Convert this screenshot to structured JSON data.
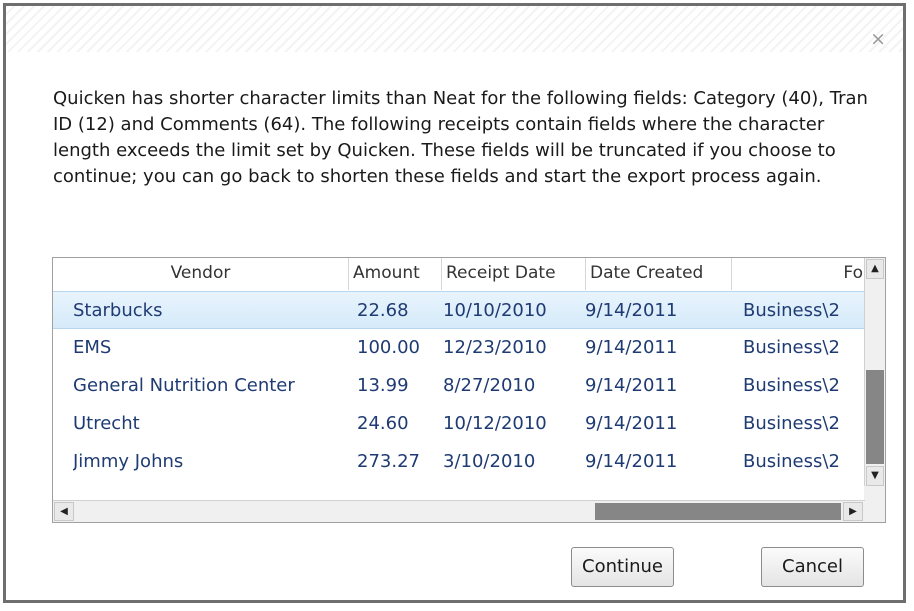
{
  "dialog": {
    "close_glyph": "×",
    "message": "Quicken has shorter character limits than Neat for the following fields: Category (40), Tran ID (12) and Comments (64). The following receipts contain fields where the character length exceeds the limit set by Quicken. These fields will be truncated if you choose to continue; you can go back to shorten these fields and start the export process again."
  },
  "table": {
    "columns": [
      "Vendor",
      "Amount",
      "Receipt Date",
      "Date Created",
      "Fo"
    ],
    "rows": [
      {
        "vendor": "Starbucks",
        "amount": "22.68",
        "receipt_date": "10/10/2010",
        "date_created": "9/14/2011",
        "folder": "Business\\2",
        "selected": true
      },
      {
        "vendor": "EMS",
        "amount": "100.00",
        "receipt_date": "12/23/2010",
        "date_created": "9/14/2011",
        "folder": "Business\\2",
        "selected": false
      },
      {
        "vendor": "General Nutrition Center",
        "amount": "13.99",
        "receipt_date": "8/27/2010",
        "date_created": "9/14/2011",
        "folder": "Business\\2",
        "selected": false
      },
      {
        "vendor": "Utrecht",
        "amount": "24.60",
        "receipt_date": "10/12/2010",
        "date_created": "9/14/2011",
        "folder": "Business\\2",
        "selected": false
      },
      {
        "vendor": "Jimmy Johns",
        "amount": "273.27",
        "receipt_date": "3/10/2010",
        "date_created": "9/14/2011",
        "folder": "Business\\2",
        "selected": false
      }
    ],
    "scroll_up_glyph": "▲",
    "scroll_down_glyph": "▼",
    "scroll_left_glyph": "◀",
    "scroll_right_glyph": "▶"
  },
  "buttons": {
    "continue": "Continue",
    "cancel": "Cancel"
  },
  "colors": {
    "selected_row": "#dbeefb",
    "row_text": "#1f3b73",
    "scroll_thumb": "#868686"
  }
}
